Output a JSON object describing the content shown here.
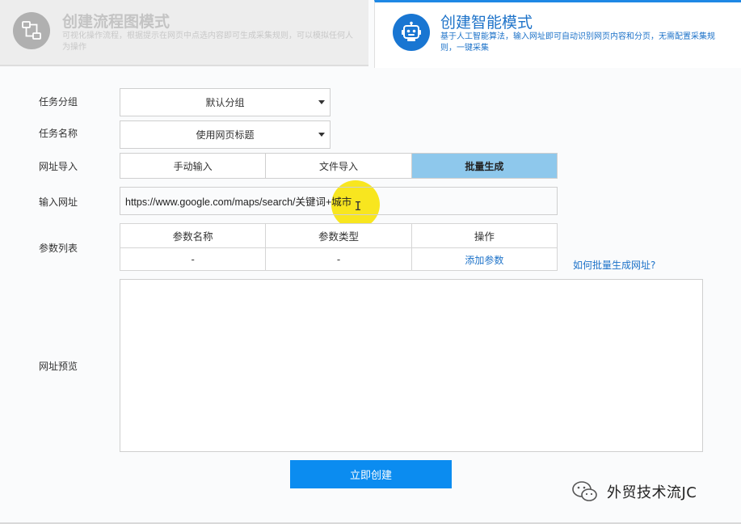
{
  "modes": {
    "flowchart": {
      "title": "创建流程图模式",
      "description": "可视化操作流程，根据提示在网页中点选内容即可生成采集规则，可以模拟任何人为操作",
      "icon": "flowchart-icon"
    },
    "smart": {
      "title": "创建智能模式",
      "description": "基于人工智能算法，输入网址即可自动识别网页内容和分页，无需配置采集规则，一键采集",
      "icon": "robot-icon"
    }
  },
  "form": {
    "task_group": {
      "label": "任务分组",
      "value": "默认分组"
    },
    "task_name": {
      "label": "任务名称",
      "value": "使用网页标题"
    },
    "url_import": {
      "label": "网址导入",
      "tabs": [
        "手动输入",
        "文件导入",
        "批量生成"
      ],
      "active_tab": "批量生成"
    },
    "url_input": {
      "label": "输入网址",
      "value": "https://www.google.com/maps/search/关键词+城市"
    },
    "param_list": {
      "label": "参数列表",
      "headers": [
        "参数名称",
        "参数类型",
        "操作"
      ],
      "row": [
        "-",
        "-",
        "添加参数"
      ],
      "help_link": "如何批量生成网址?"
    },
    "url_preview": {
      "label": "网址预览",
      "value": ""
    },
    "submit_label": "立即创建"
  },
  "watermark": {
    "text": "外贸技术流JC",
    "icon": "wechat-icon"
  },
  "colors": {
    "accent": "#1e88e5",
    "active_tab_bg": "#8ec8ec",
    "button_bg": "#0b8cf0",
    "link": "#1e73c9",
    "highlight": "#f7e200"
  }
}
